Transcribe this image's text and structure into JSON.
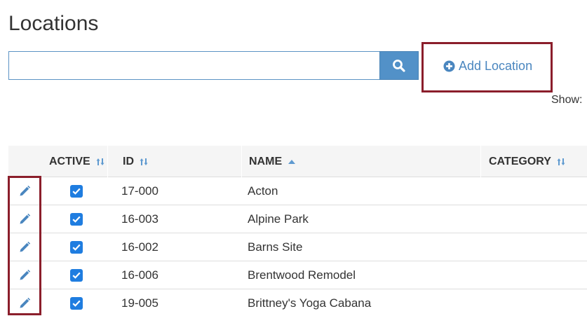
{
  "page": {
    "title": "Locations"
  },
  "search": {
    "value": "",
    "placeholder": "",
    "button_icon": "search-icon"
  },
  "actions": {
    "add_location_label": "Add Location",
    "add_location_icon": "plus-circle-icon"
  },
  "show_label": "Show:",
  "colors": {
    "accent": "#5291c8",
    "link": "#4a86bf",
    "checkbox": "#1f7de0",
    "highlight": "#8b1e2b",
    "header_bg": "#f5f5f5"
  },
  "table": {
    "columns": [
      {
        "label": "ACTIVE",
        "sort": "unsorted"
      },
      {
        "label": "ID",
        "sort": "unsorted"
      },
      {
        "label": "NAME",
        "sort": "ascending"
      },
      {
        "label": "CATEGORY",
        "sort": "unsorted"
      }
    ],
    "rows": [
      {
        "active": true,
        "id": "17-000",
        "name": "Acton",
        "category": ""
      },
      {
        "active": true,
        "id": "16-003",
        "name": "Alpine Park",
        "category": ""
      },
      {
        "active": true,
        "id": "16-002",
        "name": "Barns Site",
        "category": ""
      },
      {
        "active": true,
        "id": "16-006",
        "name": "Brentwood Remodel",
        "category": ""
      },
      {
        "active": true,
        "id": "19-005",
        "name": "Brittney's Yoga Cabana",
        "category": ""
      }
    ]
  }
}
